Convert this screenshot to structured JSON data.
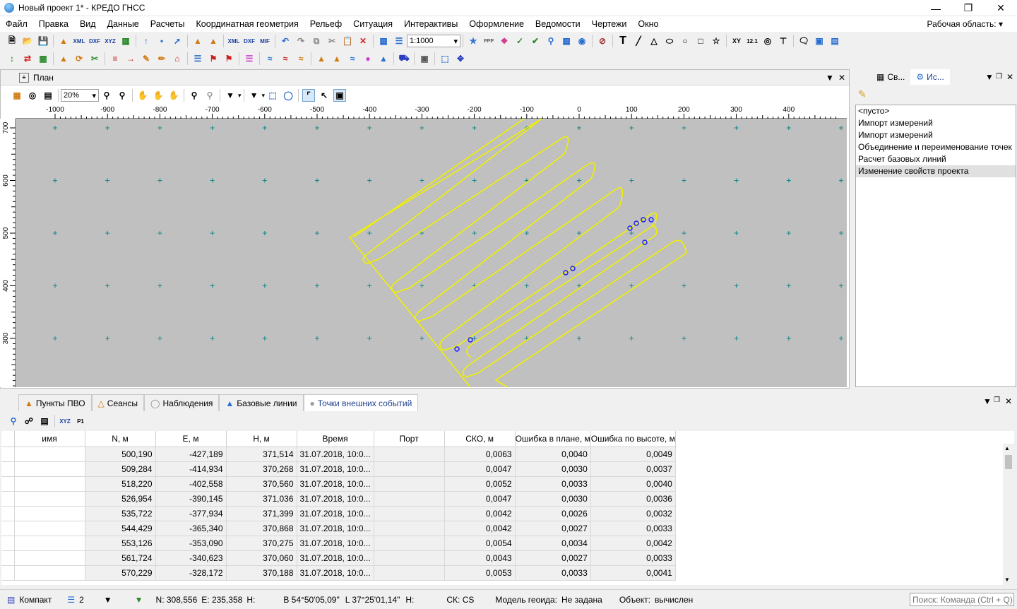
{
  "window": {
    "title": "Новый проект 1* - КРЕДО ГНСС"
  },
  "menu": [
    "Файл",
    "Правка",
    "Вид",
    "Данные",
    "Расчеты",
    "Координатная геометрия",
    "Рельеф",
    "Ситуация",
    "Интерактивы",
    "Оформление",
    "Ведомости",
    "Чертежи",
    "Окно"
  ],
  "workspace_label": "Рабочая область:",
  "toolbar": {
    "scale": "1:1000",
    "xml": "XML",
    "dxf": "DXF",
    "xyz": "XYZ",
    "mif": "MIF",
    "font_T": "T",
    "dim": "12.1"
  },
  "plan": {
    "title": "План",
    "zoom": "20%",
    "ruler_x": [
      "-1000",
      "-900",
      "-800",
      "-700",
      "-600",
      "-500",
      "-400",
      "-300",
      "-200",
      "-100",
      "0",
      "100",
      "200",
      "300",
      "400"
    ],
    "ruler_y": [
      "700",
      "600",
      "500",
      "400",
      "300"
    ]
  },
  "right_tabs": {
    "props": "Св...",
    "tools": "Ис..."
  },
  "history": [
    "<пусто>",
    "Импорт измерений",
    "Импорт измерений",
    "Объединение и переименование точек",
    "Расчет базовых линий",
    "Изменение свойств проекта"
  ],
  "bottom_tabs": [
    "Пункты ПВО",
    "Сеансы",
    "Наблюдения",
    "Базовые линии",
    "Точки внешних событий"
  ],
  "table": {
    "columns": [
      "имя",
      "N, м",
      "E, м",
      "H, м",
      "Время",
      "Порт",
      "СКО, м",
      "Ошибка в плане, м",
      "Ошибка по высоте, м"
    ],
    "rows": [
      [
        "",
        "500,190",
        "-427,189",
        "371,514",
        "31.07.2018, 10:0...",
        "",
        "0,0063",
        "0,0040",
        "0,0049"
      ],
      [
        "",
        "509,284",
        "-414,934",
        "370,268",
        "31.07.2018, 10:0...",
        "",
        "0,0047",
        "0,0030",
        "0,0037"
      ],
      [
        "",
        "518,220",
        "-402,558",
        "370,560",
        "31.07.2018, 10:0...",
        "",
        "0,0052",
        "0,0033",
        "0,0040"
      ],
      [
        "",
        "526,954",
        "-390,145",
        "371,036",
        "31.07.2018, 10:0...",
        "",
        "0,0047",
        "0,0030",
        "0,0036"
      ],
      [
        "",
        "535,722",
        "-377,934",
        "371,399",
        "31.07.2018, 10:0...",
        "",
        "0,0042",
        "0,0026",
        "0,0032"
      ],
      [
        "",
        "544,429",
        "-365,340",
        "370,868",
        "31.07.2018, 10:0...",
        "",
        "0,0042",
        "0,0027",
        "0,0033"
      ],
      [
        "",
        "553,126",
        "-353,090",
        "370,275",
        "31.07.2018, 10:0...",
        "",
        "0,0054",
        "0,0034",
        "0,0042"
      ],
      [
        "",
        "561,724",
        "-340,623",
        "370,060",
        "31.07.2018, 10:0...",
        "",
        "0,0043",
        "0,0027",
        "0,0033"
      ],
      [
        "",
        "570,229",
        "-328,172",
        "370,188",
        "31.07.2018, 10:0...",
        "",
        "0,0053",
        "0,0033",
        "0,0041"
      ]
    ]
  },
  "status": {
    "mode": "Компакт",
    "layers": "2",
    "n": "N: 308,556",
    "e": "E: 235,358",
    "h": "H:",
    "b": "B  54°50'05,09\"",
    "l": "L  37°25'01,14\"",
    "h2": "H:",
    "ck": "СК:  CS",
    "geoid_label": "Модель геоида:",
    "geoid_value": "Не задана",
    "object_label": "Объект:",
    "object_value": "вычислен",
    "command_placeholder": "Поиск: Команда (Ctrl + Q)"
  },
  "colors": {
    "track": "#f0f000",
    "points": "#1a1aff",
    "grid_cross": "#1a8a8a",
    "canvas": "#c0c0c0"
  }
}
